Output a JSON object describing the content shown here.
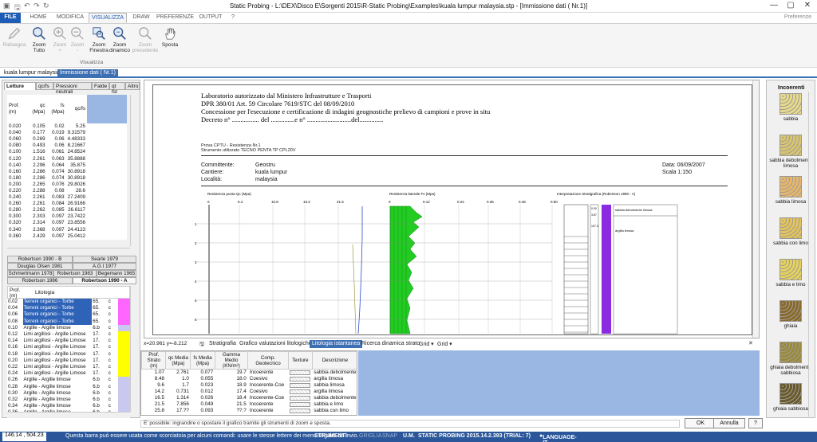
{
  "window": {
    "title": "Static Probing - L:\\DEX\\Disco E\\Sorgenti 2015\\R-Static Probing\\Examples\\kuala lumpur malaysia.stp - [Immissione dati ( Nr.1)]"
  },
  "ribbon_tabs": [
    "FILE",
    "HOME",
    "MODIFICA",
    "VISUALIZZA",
    "DRAW",
    "PREFERENZE",
    "OUTPUT",
    "?"
  ],
  "preferences_label": "Preferenze",
  "ribbon": {
    "buttons": [
      {
        "l1": "Ridisegna",
        "l2": "",
        "icon": "pencil-icon",
        "disabled": true
      },
      {
        "l1": "Zoom",
        "l2": "Tutto",
        "icon": "zoom-all-icon",
        "disabled": false
      },
      {
        "l1": "Zoom",
        "l2": "+",
        "icon": "zoom-in-icon",
        "disabled": true
      },
      {
        "l1": "Zoom",
        "l2": "-",
        "icon": "zoom-out-icon",
        "disabled": true
      },
      {
        "l1": "Zoom",
        "l2": "Finestra",
        "icon": "zoom-window-icon",
        "disabled": false
      },
      {
        "l1": "Zoom",
        "l2": "dinamico",
        "icon": "zoom-dynamic-icon",
        "disabled": false
      },
      {
        "l1": "Zoom",
        "l2": "precedente",
        "icon": "zoom-previous-icon",
        "disabled": true
      },
      {
        "l1": "Sposta",
        "l2": "",
        "icon": "hand-icon",
        "disabled": false
      }
    ],
    "group_label": "Visualizza"
  },
  "doc_tabs": [
    "kuala lumpur malaysia",
    "Immissione dati ( Nr.1)"
  ],
  "left": {
    "tabs": [
      "Letture",
      "qc/fs",
      "Pressioni neutrali",
      "Falde",
      "qt fst",
      "Altro"
    ],
    "cols": [
      "Prof. (m)",
      "qc (Mpa)",
      "fs (Mpa)",
      "qc/fs"
    ],
    "rows": [
      [
        "0.020",
        "0.105",
        "0.02",
        "5.25"
      ],
      [
        "0.040",
        "0.177",
        "0.019",
        "9.31579"
      ],
      [
        "0.060",
        "0.269",
        "0.06",
        "4.48333"
      ],
      [
        "0.080",
        "0.493",
        "0.06",
        "8.21667"
      ],
      [
        "0.100",
        "1.516",
        "0.061",
        "24.8524"
      ],
      [
        "0.120",
        "2.261",
        "0.063",
        "35.8888"
      ],
      [
        "0.140",
        "2.296",
        "0.064",
        "35.875"
      ],
      [
        "0.160",
        "2.286",
        "0.074",
        "30.8918"
      ],
      [
        "0.180",
        "2.286",
        "0.074",
        "30.8918"
      ],
      [
        "0.200",
        "2.265",
        "0.076",
        "29.8026"
      ],
      [
        "0.220",
        "2.288",
        "0.08",
        "28.6"
      ],
      [
        "0.240",
        "2.261",
        "0.083",
        "27.2409"
      ],
      [
        "0.260",
        "2.261",
        "0.084",
        "26.9166"
      ],
      [
        "0.280",
        "2.262",
        "0.085",
        "26.6117"
      ],
      [
        "0.300",
        "2.303",
        "0.097",
        "23.7422"
      ],
      [
        "0.320",
        "2.314",
        "0.097",
        "23.8556"
      ],
      [
        "0.340",
        "2.368",
        "0.097",
        "24.4123"
      ],
      [
        "0.360",
        "2.429",
        "0.097",
        "25.0412"
      ]
    ],
    "method_tabs": [
      [
        "Robertson 1990 - B",
        "Searle 1979"
      ],
      [
        "Douglas Olsen 1981",
        "A.G.I 1977"
      ],
      [
        "Schmertmann 1978",
        "Robertson 1983",
        "Begemann 1965"
      ],
      [
        "Robertson 1986",
        "Robertson 1990 - A"
      ]
    ],
    "lit_cols": [
      "Prof. (m)",
      "Litologia"
    ],
    "lit_rows": [
      [
        "0.02",
        "Terreni organici - Torbe",
        "65.",
        "c",
        "#ff66ff"
      ],
      [
        "0.04",
        "Terreni organici - Torbe",
        "65.",
        "c",
        "#ff66ff"
      ],
      [
        "0.06",
        "Terreni organici - Torbe",
        "65.",
        "c",
        "#ff66ff"
      ],
      [
        "0.08",
        "Terreni organici - Torbe",
        "65.",
        "c",
        "#ff66ff"
      ],
      [
        "0.10",
        "Argille - Argille limose",
        "6.b",
        "c",
        "#c8c8f0"
      ],
      [
        "0.12",
        "Limi argillosi - Argille Limose",
        "17.",
        "c",
        "#ffff00"
      ],
      [
        "0.14",
        "Limi argillosi - Argille Limose",
        "17.",
        "c",
        "#ffff00"
      ],
      [
        "0.16",
        "Limi argillosi - Argille Limose",
        "17.",
        "c",
        "#ffff00"
      ],
      [
        "0.18",
        "Limi argillosi - Argille Limose",
        "17.",
        "c",
        "#ffff00"
      ],
      [
        "0.20",
        "Limi argillosi - Argille Limose",
        "17.",
        "c",
        "#ffff00"
      ],
      [
        "0.22",
        "Limi argillosi - Argille Limose",
        "17.",
        "c",
        "#ffff00"
      ],
      [
        "0.24",
        "Limi argillosi - Argille Limose",
        "17.",
        "c",
        "#ffff00"
      ],
      [
        "0.26",
        "Argille - Argille limose",
        "6.b",
        "c",
        "#c8c8f0"
      ],
      [
        "0.28",
        "Argille - Argille limose",
        "6.b",
        "c",
        "#c8c8f0"
      ],
      [
        "0.30",
        "Argille - Argille limose",
        "6.b",
        "c",
        "#c8c8f0"
      ],
      [
        "0.32",
        "Argille - Argille limose",
        "6.b",
        "c",
        "#c8c8f0"
      ],
      [
        "0.34",
        "Argille - Argille limose",
        "6.b",
        "c",
        "#c8c8f0"
      ],
      [
        "0.36",
        "Argille - Argille limose",
        "6.b",
        "c",
        "#c8c8f0"
      ]
    ]
  },
  "report": {
    "h1": "Laboratorio autorizzato dal Ministero Infrastrutture e Trasporti",
    "h2": "DPR 380/01 Art. 59 Circolare 7619/STC del 08/09/2010",
    "h3": "Concessione per l'esecuzione e certificazione di indagini geognostiche prelievo di campioni e prove in situ",
    "h4": "Decreto n° ................ del ..............e n° ..........................del..............",
    "probe1": "Prova CPTU - Resistenza Nr.1",
    "probe2": "Strumento utilizzato TECNO PENTA TP CPL20V",
    "committente_label": "Committente:",
    "committente": "Geostru",
    "cantiere_label": "Cantiere:",
    "cantiere": "kuala lumpur",
    "localita_label": "Località:",
    "localita": "malaysia",
    "data": "Data: 06/09/2007",
    "scala": "Scala 1:150",
    "chart1_title": "Resistenza punta Qc (Mpa)",
    "chart1_ticks": [
      "0",
      "5.4",
      "10.8",
      "16.2",
      "21.6"
    ],
    "chart2_title": "Resistenza laterale Fs (Mpa)",
    "chart2_ticks": [
      "0",
      "0.12",
      "0.24",
      "0.36",
      "0.48",
      "0.60"
    ],
    "chart3_title": "Interpretazione Stratigrafica (Robertson 1990 - A)",
    "depth_ticks": [
      "1",
      "2",
      "3",
      "4",
      "5",
      "6"
    ],
    "strat_depths": [
      "0.00",
      "3.87",
      "107.3"
    ],
    "strat_labels": [
      "sabbia debolmente limosa",
      "argilla limosa"
    ]
  },
  "coords": "x=20.961 y=-8.212",
  "bottom_tabs": [
    "Stratigrafia",
    "Grafico valutazioni litologiche",
    "Litologia istantanea",
    "Ricerca dinamica strato",
    "Grid",
    "Grid"
  ],
  "strata": {
    "cols": [
      "Prof. Strato (m)",
      "qc Media (Mpa)",
      "fs Media (Mpa)",
      "Gamma Medio (KN/m³)",
      "Comp. Geotecnico",
      "Texture",
      "Descrizione"
    ],
    "rows": [
      [
        "1.07",
        "2.761",
        "0.077",
        "19.7",
        "Incoerente",
        "sabbia debolmente"
      ],
      [
        "8.48",
        "1.0",
        "0.055",
        "18.0",
        "Coesivo",
        "argilla limosa"
      ],
      [
        "9.6",
        "1.7",
        "0.023",
        "18.9",
        "Incoerente-Coe",
        "sabbia limosa"
      ],
      [
        "14.2",
        "0.731",
        "0.012",
        "17.4",
        "Coesivo",
        "argilla limosa"
      ],
      [
        "16.5",
        "1.314",
        "0.026",
        "18.4",
        "Incoerente-Coe",
        "sabbia debolmente"
      ],
      [
        "21.5",
        "7.856",
        "0.049",
        "21.5",
        "Incoerente",
        "sabbia e limo"
      ],
      [
        "25.8",
        "17.??",
        "0.093",
        "??.?",
        "Incoerente",
        "sabbia con limo"
      ]
    ]
  },
  "right": {
    "title": "Incoerenti",
    "items": [
      {
        "label": "sabbia",
        "color": "#e6d98a"
      },
      {
        "label": "sabbia debolmente limosa",
        "color": "#d9c56e"
      },
      {
        "label": "sabbia limosa",
        "color": "#e8b66a"
      },
      {
        "label": "sabbia con limo",
        "color": "#e3c35a"
      },
      {
        "label": "sabbia e limo",
        "color": "#e6d25a"
      },
      {
        "label": "ghiaia",
        "color": "#8a6a2a"
      },
      {
        "label": "ghiaia debolmente sabbiosa",
        "color": "#9a8a3a"
      },
      {
        "label": "ghiaia sabbiosa",
        "color": "#6a5a2a"
      }
    ]
  },
  "hint": "E' possibile: ingrandire o spostare il grafico tramite gli strumenti di zoom e sposta.",
  "buttons": {
    "ok": "OK",
    "annulla": "Annulla",
    "help": "?"
  },
  "status": {
    "coords": "146.14 , 504.23",
    "msg": "Questa barra può essere usata come scorciatoia per alcuni comandi: usare le stesse lettere dei menu seguite da invio.",
    "strumenti": "STRUMENTI",
    "griglia": "GRIGLIA",
    "snap": "SNAP",
    "um": "U.M.",
    "app": "STATIC PROBING 2015.14.2.393 (TRIAL: 7)",
    "lang": "LANGUAGE-IT"
  },
  "colors": {
    "accent": "#1e5db5",
    "status": "#2b579a",
    "green": "#22cc22",
    "purple": "#8a2be2"
  }
}
